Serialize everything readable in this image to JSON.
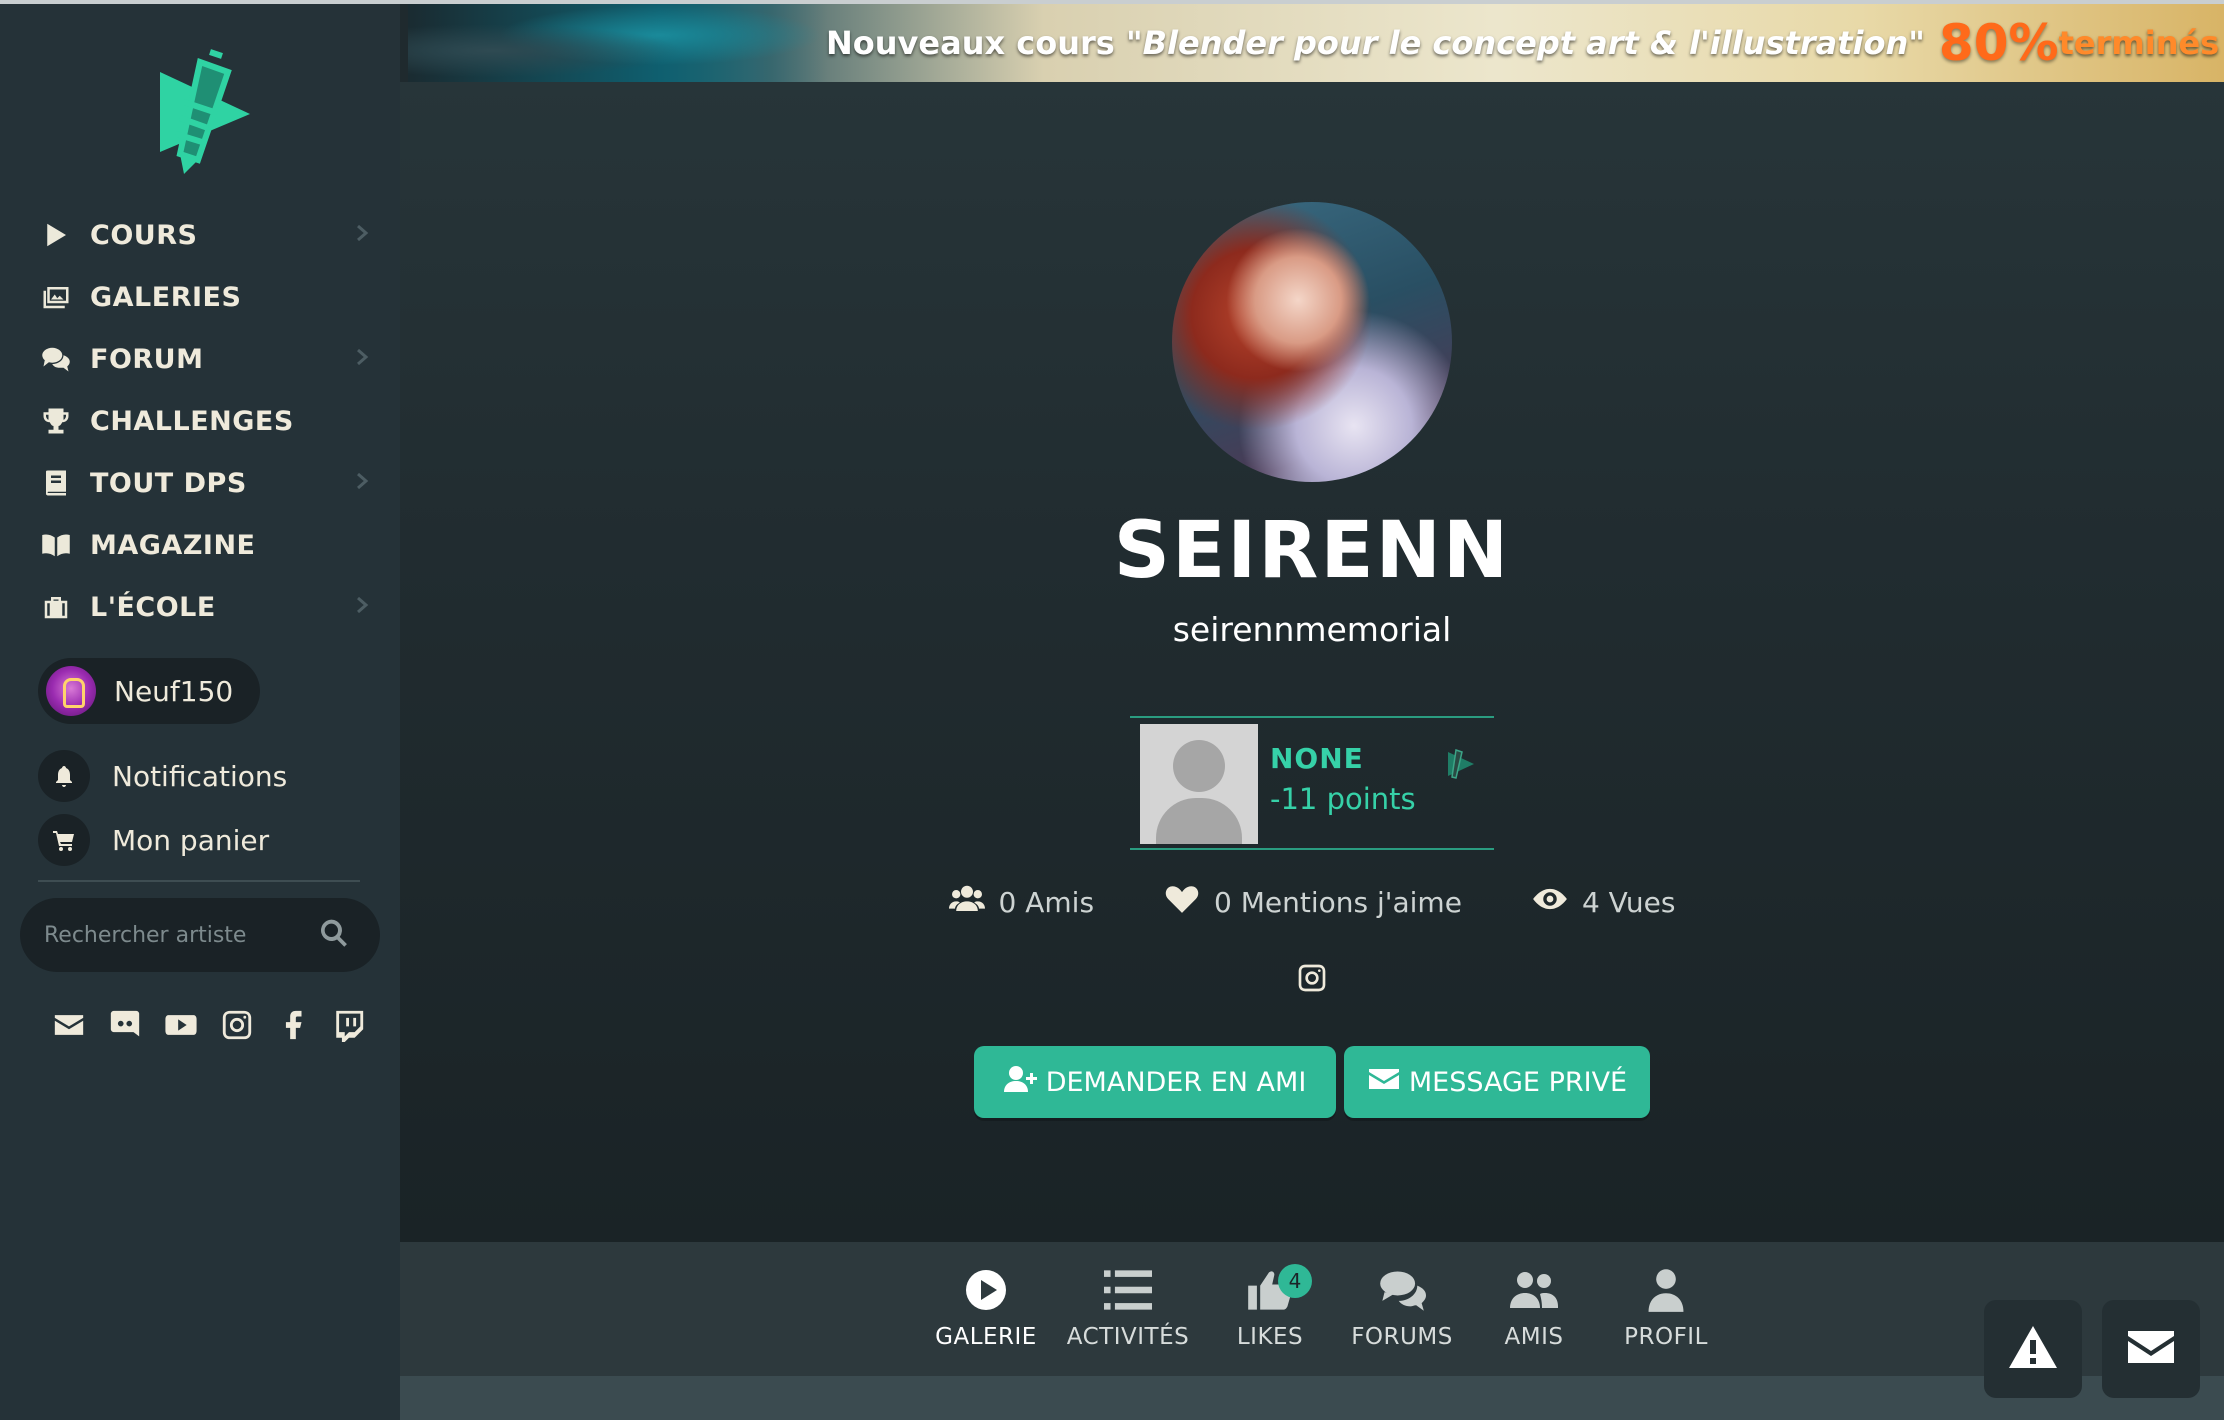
{
  "sidebar": {
    "logo_icon": "dps-logo-icon",
    "nav": [
      {
        "label": "COURS",
        "icon": "play-icon",
        "has_submenu": true
      },
      {
        "label": "GALERIES",
        "icon": "images-icon",
        "has_submenu": false
      },
      {
        "label": "FORUM",
        "icon": "comments-icon",
        "has_submenu": true
      },
      {
        "label": "CHALLENGES",
        "icon": "trophy-icon",
        "has_submenu": false
      },
      {
        "label": "TOUT DPS",
        "icon": "book-icon",
        "has_submenu": true
      },
      {
        "label": "MAGAZINE",
        "icon": "open-book-icon",
        "has_submenu": false
      },
      {
        "label": "L'ÉCOLE",
        "icon": "school-icon",
        "has_submenu": true
      }
    ],
    "user": {
      "name": "Neuf150"
    },
    "notifications_label": "Notifications",
    "cart_label": "Mon panier",
    "search_placeholder": "Rechercher artiste",
    "socials": [
      "envelope-icon",
      "discord-icon",
      "youtube-icon",
      "instagram-icon",
      "facebook-icon",
      "twitch-icon"
    ]
  },
  "banner": {
    "prefix": "Nouveaux cours \"",
    "course": "Blender pour le concept art & l'illustration",
    "suffix": "\"",
    "percent": "80%",
    "status": "terminés"
  },
  "profile": {
    "display_name": "SEIRENN",
    "username": "seirennmemorial",
    "rank": {
      "title": "NONE",
      "points": "-11 points"
    },
    "stats": {
      "friends": "0 Amis",
      "likes": "0 Mentions j'aime",
      "views": "4 Vues"
    },
    "buttons": {
      "add_friend": "DEMANDER EN AMI",
      "message": "MESSAGE PRIVÉ"
    }
  },
  "tabs": [
    {
      "label": "GALERIE",
      "icon": "play-circle-icon",
      "active": true
    },
    {
      "label": "ACTIVITÉS",
      "icon": "list-icon"
    },
    {
      "label": "LIKES",
      "icon": "thumbs-up-icon",
      "badge": "4"
    },
    {
      "label": "FORUMS",
      "icon": "comments-icon"
    },
    {
      "label": "AMIS",
      "icon": "users-icon"
    },
    {
      "label": "PROFIL",
      "icon": "user-icon"
    }
  ],
  "colors": {
    "accent": "#2fb896",
    "sidebar_bg": "#253238",
    "main_bg": "#212c30",
    "rank_text": "#36d1a8"
  }
}
